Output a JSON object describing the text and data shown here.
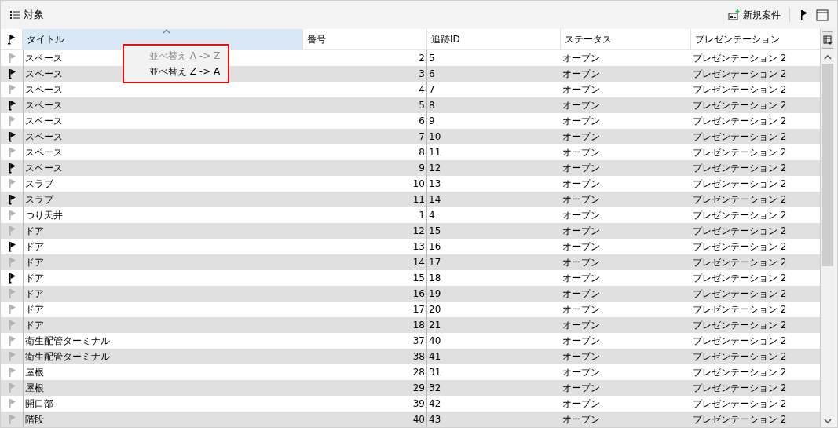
{
  "panel": {
    "title": "対象",
    "new_case_button": "新規案件"
  },
  "table": {
    "columns": [
      {
        "label": "タイトル",
        "selected": true,
        "sorted": true
      },
      {
        "label": "番号",
        "selected": false,
        "sorted": false
      },
      {
        "label": "追跡ID",
        "selected": false,
        "sorted": false
      },
      {
        "label": "ステータス",
        "selected": false,
        "sorted": false
      },
      {
        "label": "プレゼンテーション",
        "selected": false,
        "sorted": false
      }
    ],
    "rows": [
      {
        "flagged": false,
        "cells": [
          "スペース",
          "2",
          "5",
          "オープン",
          "プレゼンテーション 2"
        ]
      },
      {
        "flagged": true,
        "cells": [
          "スペース",
          "3",
          "6",
          "オープン",
          "プレゼンテーション 2"
        ]
      },
      {
        "flagged": false,
        "cells": [
          "スペース",
          "4",
          "7",
          "オープン",
          "プレゼンテーション 2"
        ]
      },
      {
        "flagged": true,
        "cells": [
          "スペース",
          "5",
          "8",
          "オープン",
          "プレゼンテーション 2"
        ]
      },
      {
        "flagged": false,
        "cells": [
          "スペース",
          "6",
          "9",
          "オープン",
          "プレゼンテーション 2"
        ]
      },
      {
        "flagged": true,
        "cells": [
          "スペース",
          "7",
          "10",
          "オープン",
          "プレゼンテーション 2"
        ]
      },
      {
        "flagged": false,
        "cells": [
          "スペース",
          "8",
          "11",
          "オープン",
          "プレゼンテーション 2"
        ]
      },
      {
        "flagged": true,
        "cells": [
          "スペース",
          "9",
          "12",
          "オープン",
          "プレゼンテーション 2"
        ]
      },
      {
        "flagged": false,
        "cells": [
          "スラブ",
          "10",
          "13",
          "オープン",
          "プレゼンテーション 2"
        ]
      },
      {
        "flagged": true,
        "cells": [
          "スラブ",
          "11",
          "14",
          "オープン",
          "プレゼンテーション 2"
        ]
      },
      {
        "flagged": false,
        "cells": [
          "つり天井",
          "1",
          "4",
          "オープン",
          "プレゼンテーション 2"
        ]
      },
      {
        "flagged": false,
        "cells": [
          "ドア",
          "12",
          "15",
          "オープン",
          "プレゼンテーション 2"
        ]
      },
      {
        "flagged": true,
        "cells": [
          "ドア",
          "13",
          "16",
          "オープン",
          "プレゼンテーション 2"
        ]
      },
      {
        "flagged": false,
        "cells": [
          "ドア",
          "14",
          "17",
          "オープン",
          "プレゼンテーション 2"
        ]
      },
      {
        "flagged": true,
        "cells": [
          "ドア",
          "15",
          "18",
          "オープン",
          "プレゼンテーション 2"
        ]
      },
      {
        "flagged": false,
        "cells": [
          "ドア",
          "16",
          "19",
          "オープン",
          "プレゼンテーション 2"
        ]
      },
      {
        "flagged": false,
        "cells": [
          "ドア",
          "17",
          "20",
          "オープン",
          "プレゼンテーション 2"
        ]
      },
      {
        "flagged": false,
        "cells": [
          "ドア",
          "18",
          "21",
          "オープン",
          "プレゼンテーション 2"
        ]
      },
      {
        "flagged": false,
        "cells": [
          "衛生配管ターミナル",
          "37",
          "40",
          "オープン",
          "プレゼンテーション 2"
        ]
      },
      {
        "flagged": false,
        "cells": [
          "衛生配管ターミナル",
          "38",
          "41",
          "オープン",
          "プレゼンテーション 2"
        ]
      },
      {
        "flagged": false,
        "cells": [
          "屋根",
          "28",
          "31",
          "オープン",
          "プレゼンテーション 2"
        ]
      },
      {
        "flagged": false,
        "cells": [
          "屋根",
          "29",
          "32",
          "オープン",
          "プレゼンテーション 2"
        ]
      },
      {
        "flagged": false,
        "cells": [
          "開口部",
          "39",
          "42",
          "オープン",
          "プレゼンテーション 2"
        ]
      },
      {
        "flagged": false,
        "cells": [
          "階段",
          "40",
          "43",
          "オープン",
          "プレゼンテーション 2"
        ]
      }
    ]
  },
  "sort_menu": {
    "items": [
      {
        "label": "並べ替え A -> Z",
        "disabled": true
      },
      {
        "label": "並べ替え Z -> A",
        "disabled": false
      }
    ]
  }
}
